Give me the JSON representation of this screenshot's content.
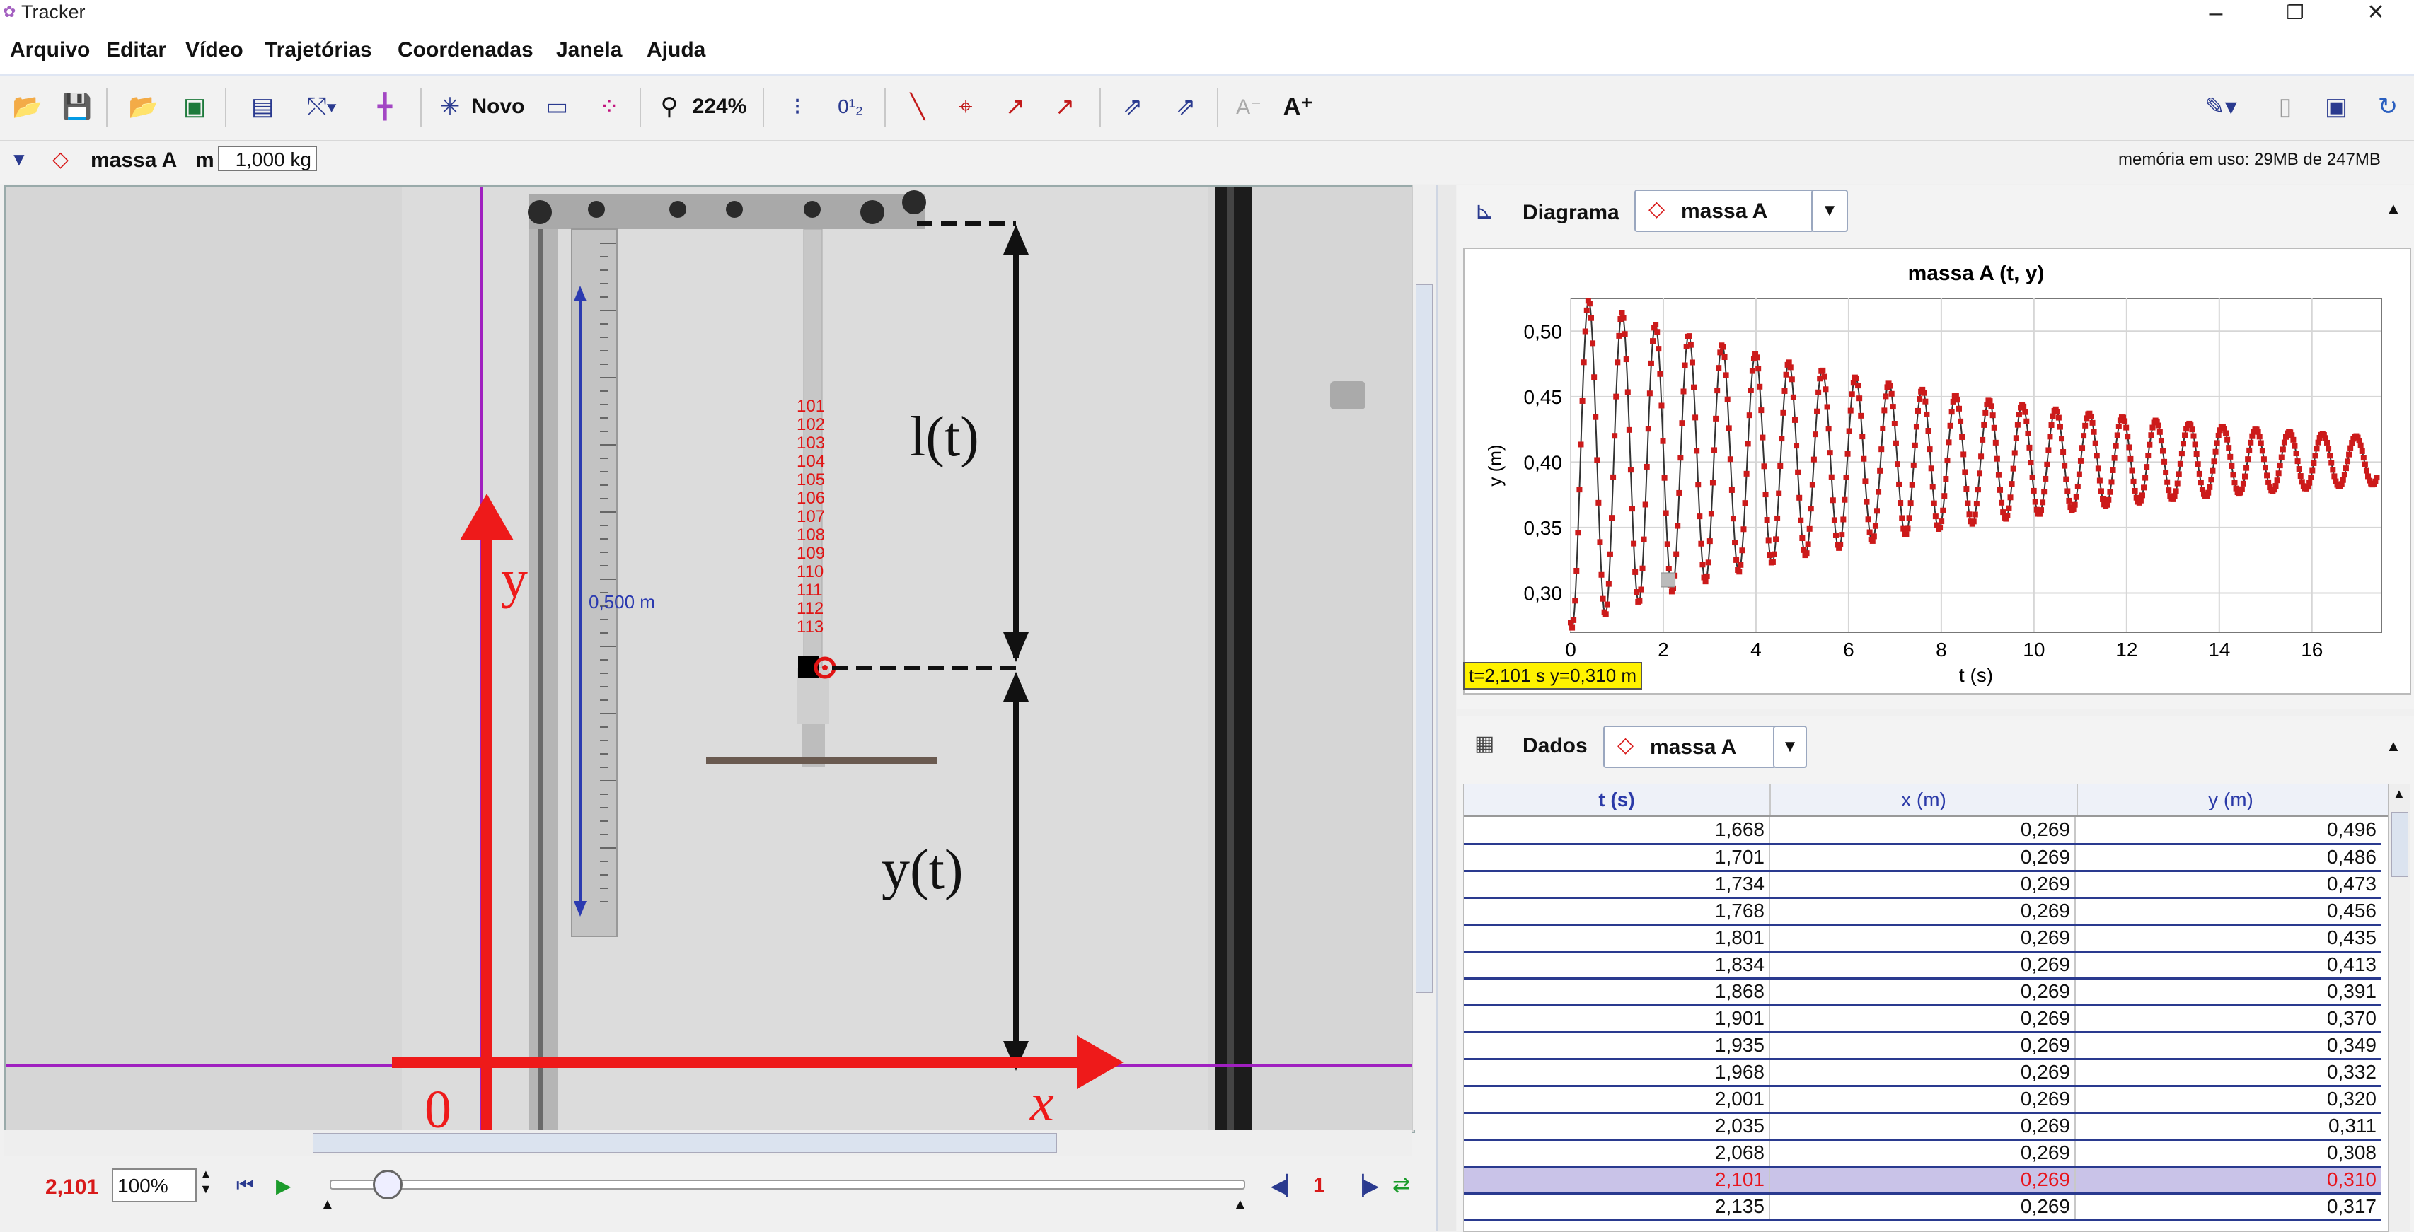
{
  "window": {
    "title": "Tracker",
    "controls": [
      "–",
      "❐",
      "✕"
    ]
  },
  "menu": [
    "Arquivo",
    "Editar",
    "Vídeo",
    "Trajetórias",
    "Coordenadas",
    "Janela",
    "Ajuda"
  ],
  "toolbar": {
    "new_label": "Novo",
    "zoom_label": "224%",
    "icons": [
      "open-icon",
      "save-icon",
      "open-folder-icon",
      "save-video-icon",
      "clip-settings-icon",
      "calibration-icon",
      "axes-icon",
      "new-track-icon",
      "ruler-icon",
      "points-icon",
      "zoom-icon",
      "trail-icon",
      "label-icon",
      "path-icon",
      "position-icon",
      "velocity-icon",
      "acceleration-icon",
      "vector-sum-icon",
      "mass-vector-icon",
      "font-smaller-icon",
      "font-larger-icon",
      "pencil-icon",
      "notes-icon",
      "panel-icon",
      "refresh-icon"
    ]
  },
  "trackbar": {
    "track_name": "massa A",
    "mass_label": "m",
    "mass_value": "1,000 kg",
    "memory": "memória em uso: 29MB de 247MB"
  },
  "video": {
    "calib_label": "0,500 m",
    "annot_l": "l(t)",
    "annot_y": "y(t)",
    "axis_y": "y",
    "axis_x": "x",
    "origin": "0",
    "frame_labels": [
      "101",
      "102",
      "103",
      "104",
      "105",
      "106",
      "107",
      "108",
      "109",
      "110",
      "111",
      "112",
      "113"
    ]
  },
  "playback": {
    "time": "2,101",
    "zoom": "100%",
    "step": "1",
    "slider_fraction": 0.06
  },
  "plot_panel": {
    "header_label": "Diagrama",
    "track": "massa A",
    "title": "massa A (t, y)",
    "xlabel": "t (s)",
    "ylabel": "y (m)",
    "readout": "t=2,101 s  y=0,310 m"
  },
  "chart_data": {
    "type": "line",
    "title": "massa A (t, y)",
    "xlabel": "t (s)",
    "ylabel": "y (m)",
    "xlim": [
      0,
      17.5
    ],
    "ylim": [
      0.27,
      0.525
    ],
    "xticks": [
      0,
      2,
      4,
      6,
      8,
      10,
      12,
      14,
      16
    ],
    "xtick_labels": [
      "0",
      "2",
      "4",
      "6",
      "8",
      "10",
      "12",
      "14",
      "16"
    ],
    "yticks": [
      0.3,
      0.35,
      0.4,
      0.45,
      0.5
    ],
    "ytick_labels": [
      "0,30",
      "0,35",
      "0,40",
      "0,45",
      "0,50"
    ],
    "grid": true,
    "series": [
      {
        "model": "damped-oscillation",
        "equilibrium": 0.401,
        "amplitude_initial": 0.128,
        "amplitude_final": 0.018,
        "period": 0.72,
        "color": "#cc1a1a"
      }
    ],
    "highlight": {
      "t": 2.101,
      "y": 0.31
    }
  },
  "data_panel": {
    "header_label": "Dados",
    "track": "massa A",
    "columns": [
      "t (s)",
      "x (m)",
      "y (m)"
    ],
    "rows": [
      [
        "1,668",
        "0,269",
        "0,496"
      ],
      [
        "1,701",
        "0,269",
        "0,486"
      ],
      [
        "1,734",
        "0,269",
        "0,473"
      ],
      [
        "1,768",
        "0,269",
        "0,456"
      ],
      [
        "1,801",
        "0,269",
        "0,435"
      ],
      [
        "1,834",
        "0,269",
        "0,413"
      ],
      [
        "1,868",
        "0,269",
        "0,391"
      ],
      [
        "1,901",
        "0,269",
        "0,370"
      ],
      [
        "1,935",
        "0,269",
        "0,349"
      ],
      [
        "1,968",
        "0,269",
        "0,332"
      ],
      [
        "2,001",
        "0,269",
        "0,320"
      ],
      [
        "2,035",
        "0,269",
        "0,311"
      ],
      [
        "2,068",
        "0,269",
        "0,308"
      ],
      [
        "2,101",
        "0,269",
        "0,310"
      ],
      [
        "2,135",
        "0,269",
        "0,317"
      ]
    ],
    "selected_row": 13
  }
}
